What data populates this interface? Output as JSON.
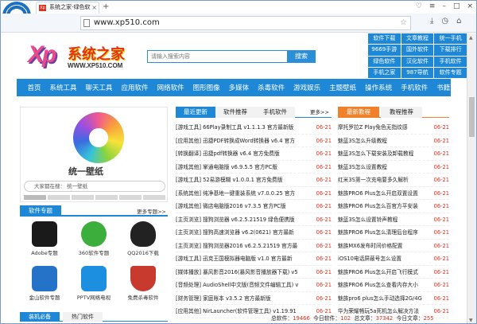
{
  "browser": {
    "tab_title": "系统之家-绿色软",
    "favicon_text": "Xp",
    "address": "www.xp510.com"
  },
  "search": {
    "placeholder": "请输入搜索内容",
    "button": "搜索"
  },
  "site": {
    "logo_xp": "Xp",
    "logo_cn": "系统之家",
    "logo_url": "WWW.XP510.COM"
  },
  "quick_links": [
    "软件下载",
    "文章教程",
    "统一手机",
    "9669手游",
    "国外软件",
    "下载排行",
    "绿色软件",
    "汉化软件",
    "手机软件",
    "手机之家",
    "987导航",
    "软件专题"
  ],
  "nav": [
    "首页",
    "系统工具",
    "聊天工具",
    "应用软件",
    "网络软件",
    "图形图像",
    "多媒体",
    "杀毒软件",
    "游戏娱乐",
    "主题壁纸",
    "操作系统",
    "手机软件",
    "书籍下载"
  ],
  "banner": {
    "title": "统一壁纸",
    "search_text": "大家都在搜：  统一壁纸"
  },
  "soft_section": {
    "title": "软件专题",
    "more": "更多专题>>"
  },
  "soft_items": [
    {
      "label": "Adobe专题",
      "icon": "adobe-icon",
      "color": "#1a1a1a"
    },
    {
      "label": "360软件专题",
      "icon": "360-icon",
      "color": "#3cae3c"
    },
    {
      "label": "QQ2016下载",
      "icon": "qq-icon",
      "color": "#222222"
    },
    {
      "label": "金山软件专题",
      "icon": "kingsoft-icon",
      "color": "#2573c9"
    },
    {
      "label": "PPTV网络电视",
      "icon": "pptv-icon",
      "color": "#1d8fe0"
    },
    {
      "label": "免费杀毒软件",
      "icon": "antivirus-icon",
      "color": "#c83a2e"
    }
  ],
  "bottom_tabs": [
    "装机必备",
    "热门软件"
  ],
  "mid_tabs": [
    "最近更新",
    "软件推荐",
    "手机软件"
  ],
  "mid_more": "更多>>",
  "mid_list": [
    {
      "title": "[游戏工具] 66Play录制工具 v1.1.1.3 官方最新版",
      "date": "06-21"
    },
    {
      "title": "[应用其他] 迅捷PDF转换成Word转换器 v6.4 官方",
      "date": "06-21"
    },
    {
      "title": "[转换翻译] 迅捷pdf转换器 v6.4 官方免费版",
      "date": "06-21"
    },
    {
      "title": "[游戏其他] 掌通电脑版 v6.9.5.5 官方PC版",
      "date": "06-21"
    },
    {
      "title": "[游戏工具] 52易游模糊 v1.0.0.1 官方免费版",
      "date": "06-21"
    },
    {
      "title": "[系统其他] 纯净基地一键重装系统 v7.0.0.25 官方",
      "date": "06-21"
    },
    {
      "title": "[游戏其他] 微店电脑版2016 v7.3.5 官方PC版",
      "date": "06-21"
    },
    {
      "title": "[主页浏览] 搜狗浏览器 v6.2.5.21519 绿色便携版",
      "date": "06-21"
    },
    {
      "title": "[主页浏览] 搜狗高速浏览器 v6.2(0621) 官方最新",
      "date": "06-21"
    },
    {
      "title": "[主页浏览] 搜狗浏览器2016 v6.2.5.21519 官方最",
      "date": "06-21"
    },
    {
      "title": "[游戏工具] 迅克王国模拟器电脑版 v1.0 官方最新",
      "date": "06-21"
    },
    {
      "title": "[媒体播放] 暴风影音2016(暴风影音播放器下载) v5",
      "date": "06-21"
    },
    {
      "title": "[音频处理] AudioShell中文版(音频文件编辑工具) v",
      "date": "06-21"
    },
    {
      "title": "[财务管理] 家庭账本 v3.5.2 官方最新版",
      "date": "06-21"
    },
    {
      "title": "[应用其他] NirLauncher(软件管理工具) v1.19.91",
      "date": "06-21"
    }
  ],
  "right_tabs": [
    "最新教程",
    "教程推荐"
  ],
  "right_list": [
    {
      "title": "摩托罗拉Z Play免色无指纹感",
      "date": "06-21"
    },
    {
      "title": "魅蓝3S怎么升级教程",
      "date": "06-21"
    },
    {
      "title": "魅蓝3S怎么下载安装及卸载教程",
      "date": "06-21"
    },
    {
      "title": "魅蓝3S怎么设置教程",
      "date": "06-21"
    },
    {
      "title": "红米3S第一次充电要多久解析",
      "date": "06-21"
    },
    {
      "title": "魅族PRO6 Plus怎么开启双置设置",
      "date": "06-21"
    },
    {
      "title": "魅族PRO6 Plus怎么百官方平安装",
      "date": "06-21"
    },
    {
      "title": "魅蓝3S怎么设置铃声教程",
      "date": "06-21"
    },
    {
      "title": "魅族PRO6 Plus怎么清理后台程序",
      "date": "06-21"
    },
    {
      "title": "魅族MX6发布时间价格配置",
      "date": "06-21"
    },
    {
      "title": "iOS10电话屏蔽号怎么设置",
      "date": "06-21"
    },
    {
      "title": "魅族PRO6 Plus怎么开启飞行模式",
      "date": "06-21"
    },
    {
      "title": "魅族PRO6 Plus怎么查看内存大小",
      "date": "06-21"
    },
    {
      "title": "魅族pro6 plus怎么手动选择2G/4G",
      "date": "06-21"
    },
    {
      "title": "华为荣耀畅玩5a死机怎么解决方法",
      "date": "06-21"
    }
  ],
  "stats": {
    "total_label": "总软件：",
    "total": "19466",
    "today_label": "今日软件：",
    "today": "102",
    "articles_label": "总文章：",
    "articles": "37342",
    "today_articles_label": "今日文章：",
    "today_articles": "255"
  }
}
